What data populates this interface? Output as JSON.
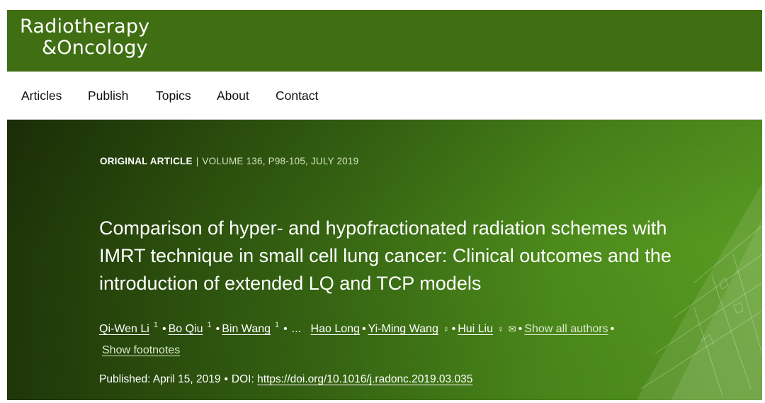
{
  "brand": {
    "line1": "Radiotherapy",
    "line2": "&Oncology",
    "color": "#3f6f12"
  },
  "nav": {
    "items": [
      "Articles",
      "Publish",
      "Topics",
      "About",
      "Contact"
    ]
  },
  "article": {
    "type": "ORIGINAL ARTICLE",
    "separator": "|",
    "citation": "VOLUME 136, P98-105, JULY 2019",
    "title_lines": [
      "Comparison of hyper- and hypofractionated radiation schemes with",
      "IMRT technique in small cell lung cancer: Clinical outcomes and the",
      "introduction of extended LQ and TCP models"
    ],
    "authors": [
      {
        "name": "Qi-Wen Li",
        "sup": "1"
      },
      {
        "name": "Bo Qiu",
        "sup": "1"
      },
      {
        "name": "Bin Wang",
        "sup": "1"
      },
      {
        "name": "Hao Long"
      },
      {
        "name": "Yi-Ming Wang",
        "icon": "person-icon"
      },
      {
        "name": "Hui Liu",
        "icons": [
          "person-icon",
          "envelope-icon"
        ]
      }
    ],
    "bullet": "•",
    "ellipsis": "...",
    "show_all_authors": "Show all authors",
    "show_footnotes": "Show footnotes",
    "published_label": "Published: April 15, 2019",
    "doi_label": "DOI:",
    "doi_link": "https://doi.org/10.1016/j.radonc.2019.03.035"
  },
  "colors": {
    "hero_dark": "#1d3208",
    "hero_light": "#5a9d22",
    "brand_green": "#3f6f12"
  }
}
